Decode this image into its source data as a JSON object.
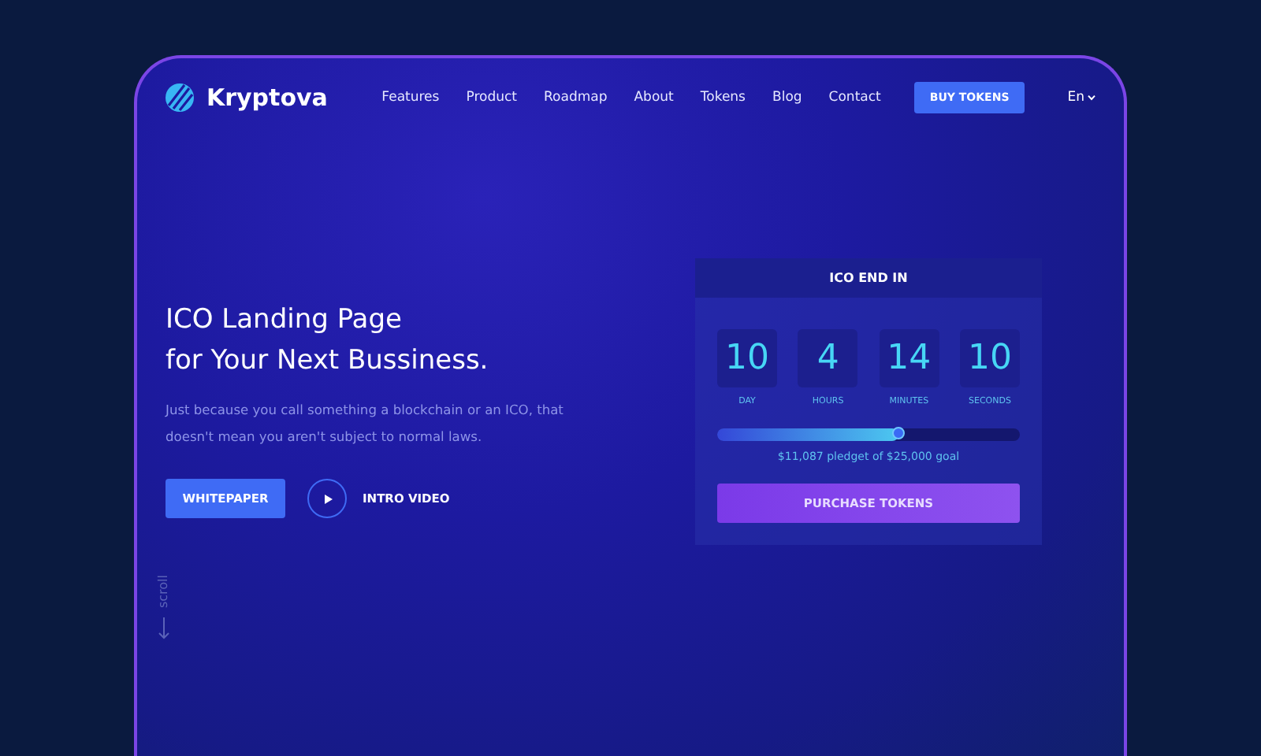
{
  "brand": "Kryptova",
  "nav": [
    "Features",
    "Product",
    "Roadmap",
    "About",
    "Tokens",
    "Blog",
    "Contact"
  ],
  "buy_button": "BUY TOKENS",
  "language": "En",
  "hero": {
    "title_lines": [
      "ICO Landing Page",
      "for Your Next Bussiness."
    ],
    "subtitle": "Just because you call something a blockchain or an ICO, that doesn't mean you aren't subject to normal laws.",
    "primary_button": "WHITEPAPER",
    "video_label": "INTRO VIDEO"
  },
  "scroll_label": "scroll",
  "countdown": {
    "title": "ICO END IN",
    "units": [
      {
        "value": "10",
        "label": "DAY"
      },
      {
        "value": "4",
        "label": "HOURS"
      },
      {
        "value": "14",
        "label": "MINUTES"
      },
      {
        "value": "10",
        "label": "SECONDS"
      }
    ],
    "progress": {
      "level": 0.6
    },
    "pledged": "$11,087 pledget of $25,000 goal",
    "button": "PURCHASE TOKENS"
  }
}
